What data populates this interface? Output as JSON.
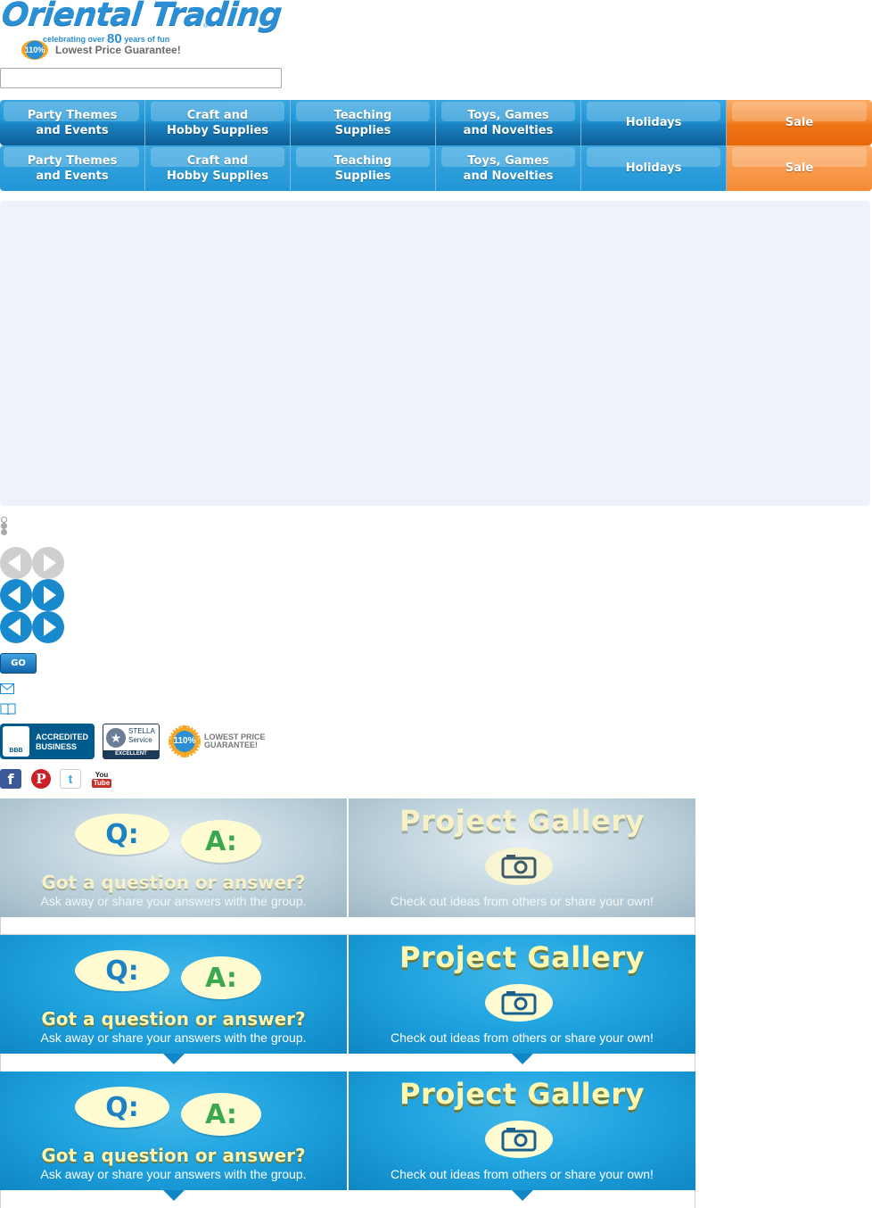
{
  "logo": {
    "wordmark": "Oriental Trading",
    "tagline_pre": "celebrating over ",
    "tagline_num": "80",
    "tagline_post": " years of fun",
    "badge": "110%",
    "guarantee": "Lowest Price Guarantee!"
  },
  "search": {
    "value": "",
    "placeholder": ""
  },
  "nav": [
    {
      "label": "Party Themes\nand Events"
    },
    {
      "label": "Craft and\nHobby Supplies"
    },
    {
      "label": "Teaching\nSupplies"
    },
    {
      "label": "Toys, Games\nand Novelties"
    },
    {
      "label": "Holidays"
    },
    {
      "label": "Sale"
    }
  ],
  "colors": {
    "nav_blue": "#2196d6",
    "nav_orange": "#f58b33",
    "accent_blue": "#1889cc"
  },
  "go_button": {
    "label": "GO"
  },
  "icons": {
    "mail": "mail-icon",
    "catalog": "book-icon"
  },
  "badges": {
    "bbb_seal": "BBB",
    "bbb_text": "ACCREDITED\nBUSINESS",
    "stella_text": "STELLA\nService",
    "stella_bar": "EXCELLENT",
    "lpg_seal": "110%",
    "lpg_text": "LOWEST PRICE\nGUARANTEE!"
  },
  "social": {
    "facebook": "f",
    "pinterest": "P",
    "twitter": "t",
    "youtube_you": "You",
    "youtube_tube": "Tube"
  },
  "community": {
    "qa_q": "Q:",
    "qa_a": "A:",
    "qa_headline": "Got a question or answer?",
    "qa_sub": "Ask away or share your answers with the group.",
    "gallery_title": "Project Gallery",
    "gallery_sub": "Check out ideas from others or share your own!"
  }
}
